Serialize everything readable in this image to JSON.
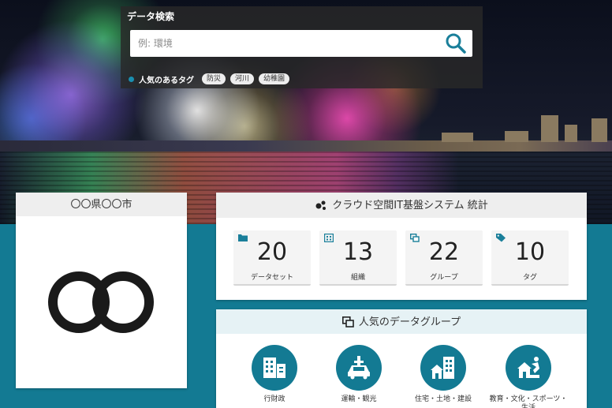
{
  "search": {
    "title": "データ検索",
    "placeholder": "例: 環境",
    "popular_tags_label": "人気のあるタグ",
    "tags": [
      "防災",
      "河川",
      "幼稚園"
    ]
  },
  "municipality": {
    "name": "〇〇県〇〇市"
  },
  "stats": {
    "title": "クラウド空間IT基盤システム 統計",
    "items": [
      {
        "value": "20",
        "label": "データセット",
        "icon": "folder-icon"
      },
      {
        "value": "13",
        "label": "組織",
        "icon": "building-icon"
      },
      {
        "value": "22",
        "label": "グループ",
        "icon": "group-icon"
      },
      {
        "value": "10",
        "label": "タグ",
        "icon": "tag-icon"
      }
    ]
  },
  "groups": {
    "title": "人気のデータグループ",
    "items": [
      {
        "label": "行財政",
        "icon": "office-building-icon"
      },
      {
        "label": "運輸・観光",
        "icon": "transport-icon"
      },
      {
        "label": "住宅・土地・建設",
        "icon": "housing-icon"
      },
      {
        "label": "教育・文化・スポーツ・生活",
        "icon": "education-icon"
      }
    ]
  },
  "colors": {
    "accent": "#137a93",
    "card_header": "#eeeeee",
    "tag_dot": "#1a8fb0"
  }
}
